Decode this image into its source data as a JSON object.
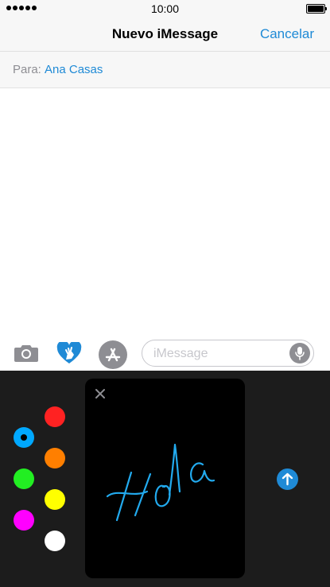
{
  "status_bar": {
    "time": "10:00"
  },
  "nav": {
    "title": "Nuevo iMessage",
    "cancel_label": "Cancelar"
  },
  "recipient": {
    "label": "Para:",
    "name": "Ana Casas"
  },
  "input": {
    "placeholder": "iMessage"
  },
  "icons": {
    "camera": "camera-icon",
    "digital_touch": "heart-hand-icon",
    "app_store": "app-store-icon",
    "microphone": "microphone-icon",
    "close": "close-icon",
    "send": "arrow-up-icon"
  },
  "colors": {
    "accent": "#1f8ad6",
    "palette": [
      "#00a8ff",
      "#ff2222",
      "#ff7f00",
      "#22ee22",
      "#ffff00",
      "#ff00ff",
      "#ffffff"
    ],
    "selected": "#00a8ff",
    "ink": "#22aaee"
  },
  "drawing": {
    "handwriting": "Hola"
  }
}
